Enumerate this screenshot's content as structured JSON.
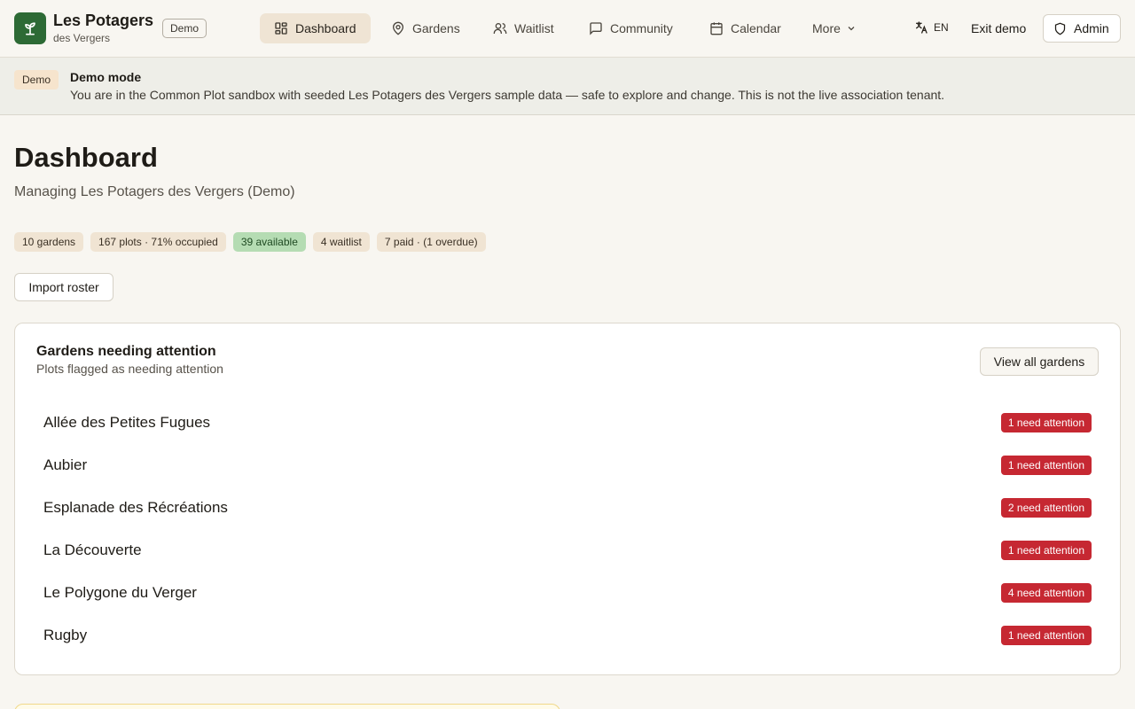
{
  "brand": {
    "title": "Les Potagers",
    "subtitle": "des Vergers",
    "demo_chip": "Demo"
  },
  "nav": [
    {
      "label": "Dashboard",
      "icon": "dashboard-icon",
      "active": true
    },
    {
      "label": "Gardens",
      "icon": "map-pin-icon"
    },
    {
      "label": "Waitlist",
      "icon": "users-icon"
    },
    {
      "label": "Community",
      "icon": "message-icon"
    },
    {
      "label": "Calendar",
      "icon": "calendar-icon"
    },
    {
      "label": "More",
      "icon": "chevron-down-icon"
    }
  ],
  "header_right": {
    "language": "EN",
    "exit_demo": "Exit demo",
    "admin": "Admin"
  },
  "banner": {
    "badge": "Demo",
    "title": "Demo mode",
    "text": "You are in the Common Plot sandbox with seeded Les Potagers des Vergers sample data — safe to explore and change. This is not the live association tenant."
  },
  "page": {
    "title": "Dashboard",
    "subtitle": "Managing Les Potagers des Vergers (Demo)",
    "stats": [
      "10 gardens",
      "167 plots · 71% occupied",
      "39 available",
      "4 waitlist",
      "7 paid · (1 overdue)"
    ],
    "import_button": "Import roster"
  },
  "attention_card": {
    "title": "Gardens needing attention",
    "subtitle": "Plots flagged as needing attention",
    "view_all": "View all gardens",
    "gardens": [
      {
        "name": "Allée des Petites Fugues",
        "badge": "1 need attention"
      },
      {
        "name": "Aubier",
        "badge": "1 need attention"
      },
      {
        "name": "Esplanade des Récréations",
        "badge": "2 need attention"
      },
      {
        "name": "La Découverte",
        "badge": "1 need attention"
      },
      {
        "name": "Le Polygone du Verger",
        "badge": "4 need attention"
      },
      {
        "name": "Rugby",
        "badge": "1 need attention"
      }
    ]
  },
  "colors": {
    "brand_green": "#2d6a35",
    "attention_red": "#c62832",
    "available_green": "#b5dcb3",
    "nav_active": "#efe4d4"
  }
}
